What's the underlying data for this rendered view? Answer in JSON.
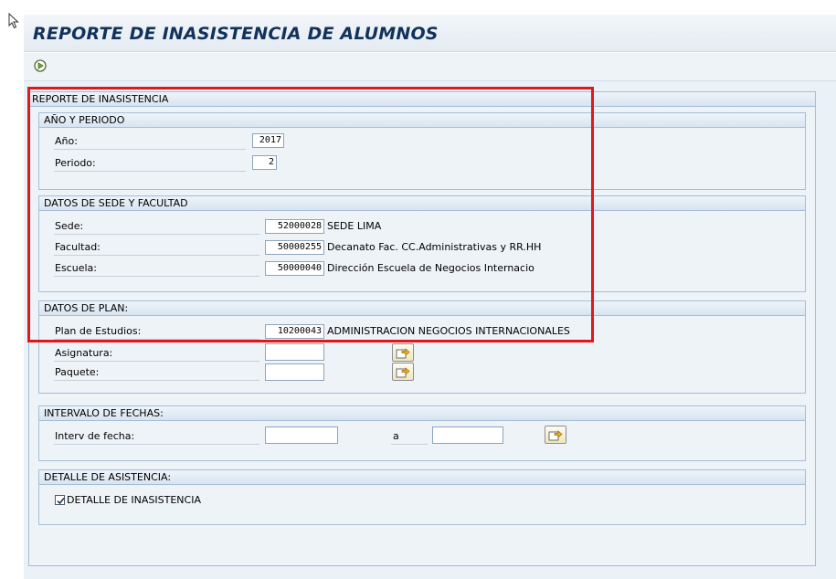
{
  "window": {
    "title": "REPORTE DE INASISTENCIA DE ALUMNOS"
  },
  "toolbar": {
    "execute_icon": "execute-icon"
  },
  "main": {
    "title": "REPORTE DE INASISTENCIA"
  },
  "groups": {
    "ano_periodo": {
      "title": "AÑO Y PERIODO",
      "ano_label": "Año:",
      "ano_value": "2017",
      "periodo_label": "Periodo:",
      "periodo_value": "2"
    },
    "sede_facultad": {
      "title": "DATOS DE SEDE Y FACULTAD",
      "sede_label": "Sede:",
      "sede_value": "52000028",
      "sede_desc": "SEDE LIMA",
      "facultad_label": "Facultad:",
      "facultad_value": "50000255",
      "facultad_desc": "Decanato Fac. CC.Administrativas y RR.HH",
      "escuela_label": "Escuela:",
      "escuela_value": "50000040",
      "escuela_desc": "Dirección Escuela de Negocios Internacio"
    },
    "plan": {
      "title": "DATOS DE PLAN:",
      "plan_label": "Plan de Estudios:",
      "plan_value": "10200043",
      "plan_desc": "ADMINISTRACION NEGOCIOS INTERNACIONALES",
      "asignatura_label": "Asignatura:",
      "asignatura_value": "",
      "paquete_label": "Paquete:",
      "paquete_value": ""
    },
    "fechas": {
      "title": "INTERVALO DE FECHAS:",
      "interv_label": "Interv de fecha:",
      "from_value": "",
      "to_label": "a",
      "to_value": ""
    },
    "detalle": {
      "title": "DETALLE DE ASISTENCIA:",
      "checkbox_label": "DETALLE DE INASISTENCIA",
      "checked": true
    }
  },
  "colors": {
    "title_text": "#11325b",
    "highlight": "#e0181c",
    "group_border": "#a5bdd6",
    "panel_bg": "#eaf1f7"
  }
}
